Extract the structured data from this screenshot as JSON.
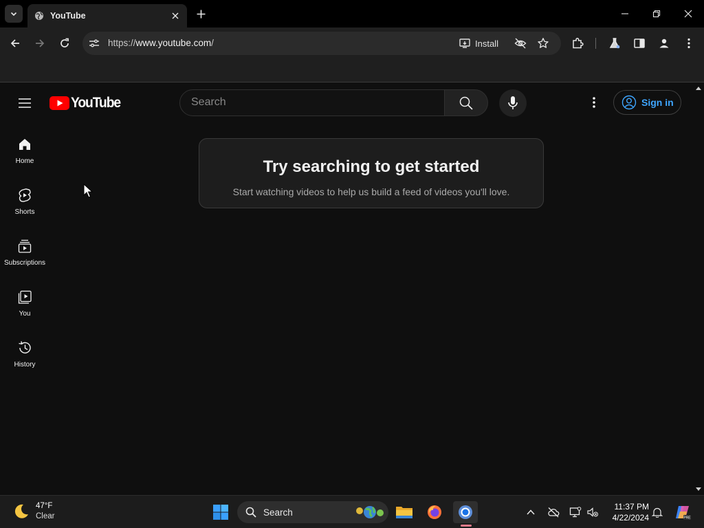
{
  "browser": {
    "tab_title": "YouTube",
    "url_prefix": "https://",
    "url_host": "www.youtube.com",
    "url_suffix": "/",
    "install_label": "Install"
  },
  "youtube": {
    "logo_text": "YouTube",
    "search_placeholder": "Search",
    "signin_label": "Sign in",
    "guide": [
      {
        "label": "Home",
        "icon": "home-icon"
      },
      {
        "label": "Shorts",
        "icon": "shorts-icon"
      },
      {
        "label": "Subscriptions",
        "icon": "subscriptions-icon"
      },
      {
        "label": "You",
        "icon": "you-icon"
      },
      {
        "label": "History",
        "icon": "history-icon"
      }
    ],
    "promo_title": "Try searching to get started",
    "promo_body": "Start watching videos to help us build a feed of videos you'll love."
  },
  "taskbar": {
    "temperature": "47°F",
    "condition": "Clear",
    "search_label": "Search",
    "time": "11:37 PM",
    "date": "4/22/2024"
  },
  "colors": {
    "page_bg": "#0f0f0f",
    "brand_red": "#ff0000",
    "link_blue": "#3ea6ff"
  }
}
